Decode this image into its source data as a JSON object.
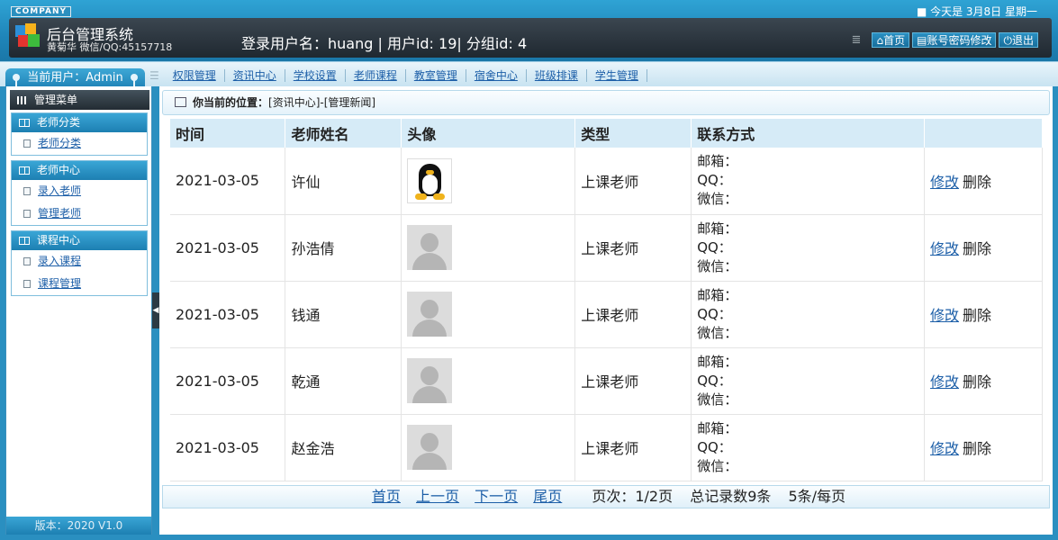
{
  "header": {
    "company": "COMPANY",
    "date_text": "■ 今天是 3月8日 星期一",
    "title": "后台管理系统",
    "author": "黄菊华 微信/QQ:45157718",
    "login_info": "登录用户名：huang | 用户id: 19| 分组id: 4",
    "buttons": {
      "home": "首页",
      "account": "账号密码修改",
      "logout": "退出"
    }
  },
  "nav": {
    "current_user": "当前用户：Admin",
    "items": [
      "权限管理",
      "资讯中心",
      "学校设置",
      "老师课程",
      "教室管理",
      "宿舍中心",
      "班级排课",
      "学生管理"
    ]
  },
  "sidebar": {
    "menu_title": "管理菜单",
    "sections": [
      {
        "title": "老师分类",
        "items": [
          "老师分类"
        ]
      },
      {
        "title": "老师中心",
        "items": [
          "录入老师",
          "管理老师"
        ]
      },
      {
        "title": "课程中心",
        "items": [
          "录入课程",
          "课程管理"
        ]
      }
    ],
    "footer": "版本：2020 V1.0"
  },
  "location": {
    "label": "你当前的位置：",
    "path": "[资讯中心]-[管理新闻]"
  },
  "table": {
    "headers": [
      "时间",
      "老师姓名",
      "头像",
      "类型",
      "联系方式",
      ""
    ],
    "contact_labels": [
      "邮箱：",
      "QQ：",
      "微信："
    ],
    "edit_label": "修改",
    "delete_label": "删除",
    "rows": [
      {
        "time": "2021-03-05",
        "name": "许仙",
        "avatar": "tux-penguin-avatar",
        "type": "上课老师"
      },
      {
        "time": "2021-03-05",
        "name": "孙浩倩",
        "avatar": "default-user-avatar",
        "type": "上课老师"
      },
      {
        "time": "2021-03-05",
        "name": "钱通",
        "avatar": "default-user-avatar",
        "type": "上课老师"
      },
      {
        "time": "2021-03-05",
        "name": "乾通",
        "avatar": "default-user-avatar",
        "type": "上课老师"
      },
      {
        "time": "2021-03-05",
        "name": "赵金浩",
        "avatar": "default-user-avatar",
        "type": "上课老师"
      }
    ]
  },
  "pager": {
    "first": "首页",
    "prev": "上一页",
    "next": "下一页",
    "last": "尾页",
    "page_info": "页次：1/2页",
    "total_info": "总记录数9条",
    "per_page": "5条/每页"
  }
}
